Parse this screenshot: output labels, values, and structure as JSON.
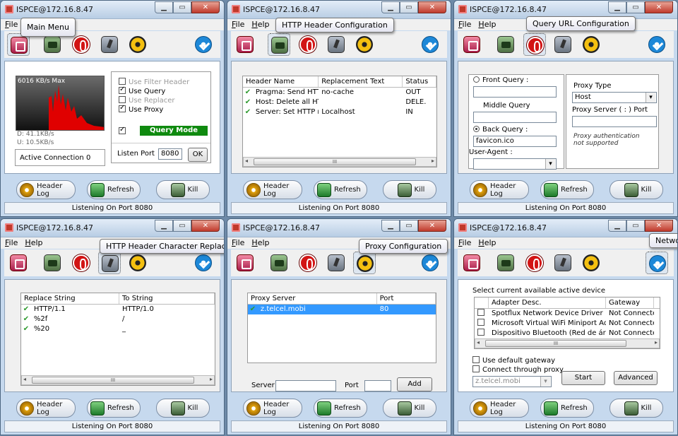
{
  "common": {
    "window_title": "ISPCE@172.16.8.47",
    "menu_file": "File",
    "menu_help": "Help",
    "header_log": "Header Log",
    "refresh": "Refresh",
    "kill": "Kill",
    "status": "Listening On Port 8080"
  },
  "w1": {
    "tooltip": "Main Menu",
    "menu_file_trunc": "File",
    "graph_max": "6016 KB/s Max",
    "down": "D: 41.1KB/s",
    "up": "U: 10.5KB/s",
    "active_label": "Active Connection",
    "active_value": "0",
    "opt_filter": "Use Filter Header",
    "opt_query": "Use Query",
    "opt_replacer": "Use Replacer",
    "opt_proxy": "Use Proxy",
    "query_mode": "Query Mode",
    "listen_label": "Listen Port",
    "listen_value": "8080",
    "ok": "OK"
  },
  "w2": {
    "tooltip": "HTTP Header Configuration",
    "col_name": "Header Name",
    "col_repl": "Replacement Text",
    "col_status": "Status",
    "rows": [
      {
        "name": "Pragma: Send HTT...",
        "repl": "no-cache",
        "status": "OUT"
      },
      {
        "name": "Host: Delete all HT...",
        "repl": "",
        "status": "DELE."
      },
      {
        "name": "Server: Set HTTP r...",
        "repl": "Localhost",
        "status": "IN"
      }
    ],
    "scroll_thumb": "III"
  },
  "w3": {
    "tooltip": "Query URL Configuration",
    "front": "Front Query :",
    "middle": "Middle Query",
    "back": "Back Query :",
    "back_value": "favicon.ico",
    "ua": "User-Agent :",
    "proxy_type": "Proxy Type",
    "proxy_type_value": "Host",
    "proxy_server": "Proxy Server ( : ) Port",
    "auth_note": "Proxy authentication not supported"
  },
  "w4": {
    "tooltip": "HTTP Header Character Replacer",
    "col_from": "Replace String",
    "col_to": "To String",
    "rows": [
      {
        "from": "HTTP/1.1",
        "to": "HTTP/1.0"
      },
      {
        "from": "%2f",
        "to": "/"
      },
      {
        "from": "%20",
        "to": "_"
      }
    ],
    "scroll_thumb": "III"
  },
  "w5": {
    "tooltip": "Proxy Configuration",
    "col_server": "Proxy Server",
    "col_port": "Port",
    "row_server": "z.telcel.mobi",
    "row_port": "80",
    "server_label": "Server",
    "port_label": "Port",
    "add": "Add"
  },
  "w6": {
    "tooltip": "Netwo",
    "select_label": "Select current available active device",
    "col_adapter": "Adapter Desc.",
    "col_gateway": "Gateway",
    "rows": [
      {
        "adapter": "Spotflux Network Device Driver",
        "gateway": "Not Connected"
      },
      {
        "adapter": "Microsoft Virtual WiFi Miniport Adapter",
        "gateway": "Not Connected"
      },
      {
        "adapter": "Dispositivo Bluetooth (Red de área pe...",
        "gateway": "Not Connected"
      }
    ],
    "scroll_thumb": "III",
    "use_gateway": "Use default gateway",
    "connect_proxy": "Connect through proxy",
    "proxy_value": "z.telcel.mobi",
    "start": "Start",
    "advanced": "Advanced"
  },
  "colors": {
    "graph_red": "#e00000",
    "query_mode_bg": "#0f8a0f",
    "selection_blue": "#3399ff"
  },
  "icons": [
    "main-menu-icon",
    "http-header-icon",
    "query-url-icon",
    "char-replacer-icon",
    "proxy-icon",
    "network-icon"
  ]
}
